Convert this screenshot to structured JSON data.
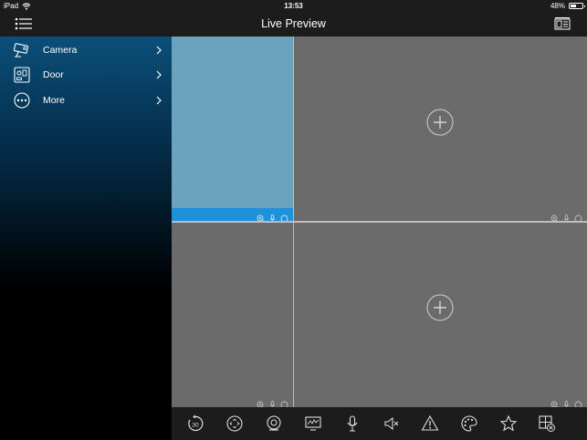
{
  "status_bar": {
    "device": "iPad",
    "time": "13:53",
    "battery_text": "48%",
    "battery_level": 0.48
  },
  "nav_bar": {
    "title": "Live Preview"
  },
  "sidebar": {
    "items": [
      {
        "label": "Camera",
        "icon": "camera-icon"
      },
      {
        "label": "Door",
        "icon": "door-panel-icon"
      },
      {
        "label": "More",
        "icon": "more-icon"
      }
    ]
  },
  "colors": {
    "active_pane": "#6ba3bf",
    "active_pane_bar": "#1e92d8",
    "pane": "#6b6b6b",
    "sidebar_top": "#0b4f79"
  },
  "toolbar": {
    "items": [
      "replay-30-icon",
      "fullscreen-icon",
      "snapshot-icon",
      "video-stream-icon",
      "microphone-icon",
      "speaker-mute-icon",
      "alarm-warning-icon",
      "color-palette-icon",
      "favorite-star-icon",
      "close-all-icon"
    ]
  }
}
